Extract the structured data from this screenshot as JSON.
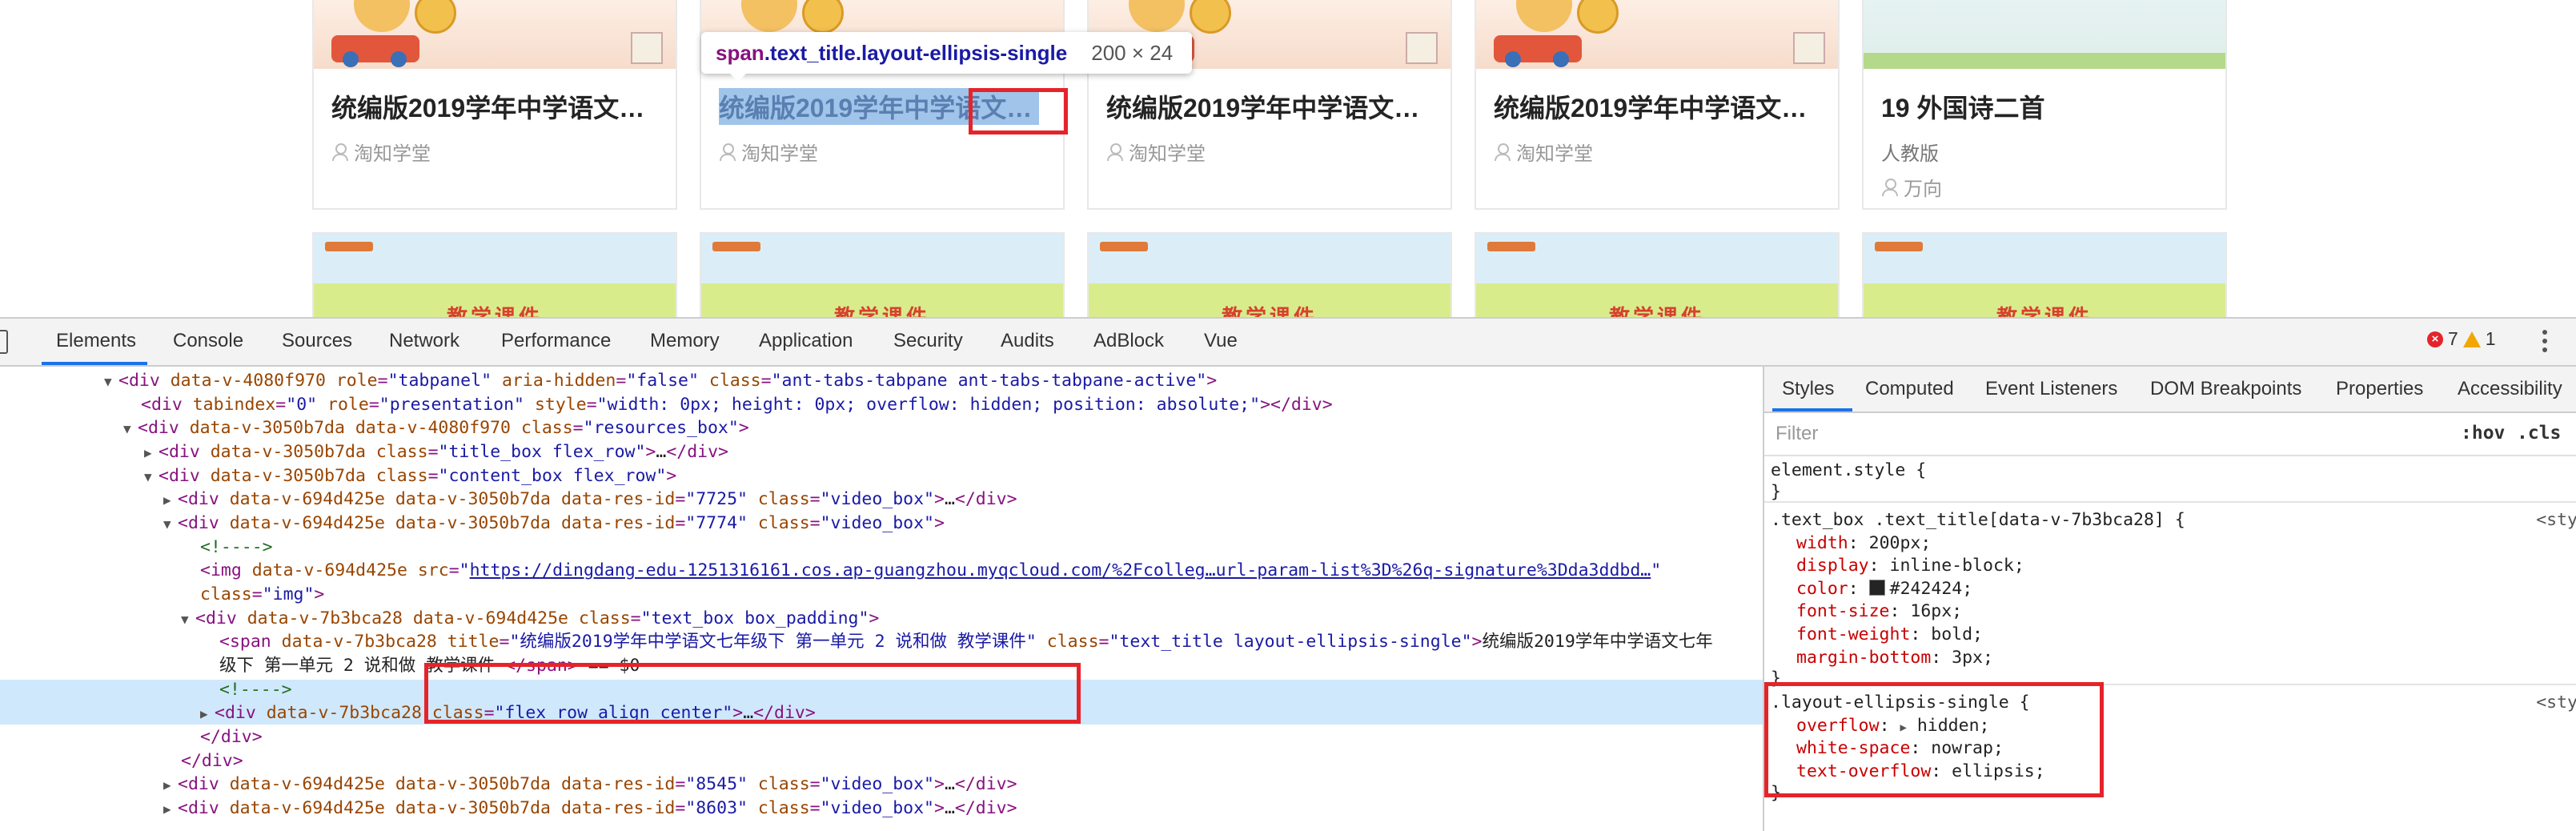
{
  "page": {
    "cards": [
      {
        "title": "统编版2019学年中学语文…",
        "author": "淘知学堂"
      },
      {
        "title": "统编版2019学年中学语文…",
        "author": "淘知学堂"
      },
      {
        "title": "统编版2019学年中学语文…",
        "author": "淘知学堂"
      },
      {
        "title": "统编版2019学年中学语文…",
        "author": "淘知学堂"
      },
      {
        "title": "19 外国诗二首",
        "publisher": "人教版",
        "author": "万向"
      }
    ],
    "thumb_text": "教学课件"
  },
  "tooltip": {
    "tag": "span",
    "classes": ".text_title.layout-ellipsis-single",
    "size": "200 × 24"
  },
  "devtools": {
    "tabs": [
      "Elements",
      "Console",
      "Sources",
      "Network",
      "Performance",
      "Memory",
      "Application",
      "Security",
      "Audits",
      "AdBlock",
      "Vue"
    ],
    "active_tab": "Elements",
    "errors": "7",
    "warnings": "1",
    "dom": [
      {
        "t": "<div data-v-4080f970 role=\"tabpanel\" aria-hidden=\"false\" class=\"ant-tabs-tabpane ant-tabs-tabpane-active\">"
      },
      {
        "t": "<div tabindex=\"0\" role=\"presentation\" style=\"width: 0px; height: 0px; overflow: hidden; position: absolute;\"></div>"
      },
      {
        "t": "<div data-v-3050b7da data-v-4080f970 class=\"resources_box\">"
      },
      {
        "t": "<div data-v-3050b7da class=\"title_box flex_row\">…</div>"
      },
      {
        "t": "<div data-v-3050b7da class=\"content_box flex_row\">"
      },
      {
        "t": "<div data-v-694d425e data-v-3050b7da data-res-id=\"7725\" class=\"video_box\">…</div>"
      },
      {
        "t": "<div data-v-694d425e data-v-3050b7da data-res-id=\"7774\" class=\"video_box\">"
      },
      {
        "t": "<!---->"
      },
      {
        "t": "<img data-v-694d425e src=\"https://dingdang-edu-1251316161.cos.ap-guangzhou.myqcloud.com/%2Fcolleg…url-param-list%3D%26q-signature%3Dda3ddbd…\""
      },
      {
        "t": "class=\"img\">"
      },
      {
        "t": "<div data-v-7b3bca28 data-v-694d425e class=\"text_box box_padding\">"
      },
      {
        "t": "<span data-v-7b3bca28 title=\"统编版2019学年中学语文七年级下 第一单元 2 说和做 教学课件\" class=\"text_title layout-ellipsis-single\">统编版2019学年中学语文七年"
      },
      {
        "t": "级下 第一单元 2 说和做 教学课件 </span> == $0"
      },
      {
        "t": "<!---->"
      },
      {
        "t": "<div data-v-7b3bca28 class=\"flex_row_align_center\">…</div>"
      },
      {
        "t": "</div>"
      },
      {
        "t": "</div>"
      },
      {
        "t": "<div data-v-694d425e data-v-3050b7da data-res-id=\"8545\" class=\"video_box\">…</div>"
      },
      {
        "t": "<div data-v-694d425e data-v-3050b7da data-res-id=\"8603\" class=\"video_box\">…</div>"
      }
    ],
    "styles": {
      "tabs": [
        "Styles",
        "Computed",
        "Event Listeners",
        "DOM Breakpoints",
        "Properties",
        "Accessibility"
      ],
      "filter_placeholder": "Filter",
      "hov": ":hov",
      "cls": ".cls",
      "element_style": "element.style {",
      "rule1_selector": ".text_box .text_title[data-v-7b3bca28] {",
      "rule1_src": "<sty",
      "rule1_props": [
        {
          "p": "width",
          "v": "200px;"
        },
        {
          "p": "display",
          "v": "inline-block;"
        },
        {
          "p": "color",
          "v": "#242424;"
        },
        {
          "p": "font-size",
          "v": "16px;"
        },
        {
          "p": "font-weight",
          "v": "bold;"
        },
        {
          "p": "margin-bottom",
          "v": "3px;"
        }
      ],
      "rule2_selector": ".layout-ellipsis-single {",
      "rule2_src": "<sty",
      "rule2_props": [
        {
          "p": "overflow",
          "v": "hidden;"
        },
        {
          "p": "white-space",
          "v": "nowrap;"
        },
        {
          "p": "text-overflow",
          "v": "ellipsis;"
        }
      ]
    }
  },
  "colors": {
    "highlight_red": "#e5242a",
    "selection": "#cfe8fc",
    "accent": "#1a73e8"
  }
}
